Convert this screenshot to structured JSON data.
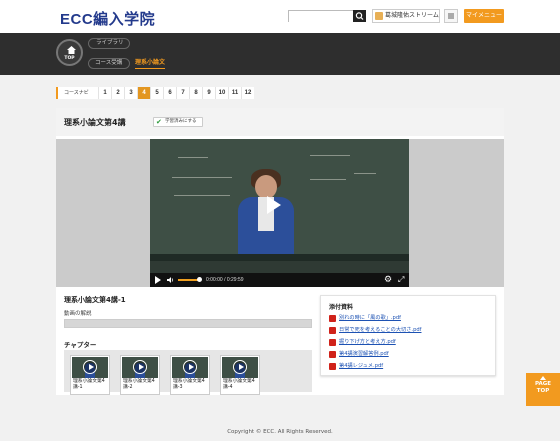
{
  "header": {
    "logo": "ECC編入学院",
    "search": {
      "placeholder": "",
      "value": ""
    },
    "user_name": "葛城隆佑ストリーム",
    "mymenu_label": "マイメニュー"
  },
  "nav": {
    "top_label": "TOP",
    "library_label": "ライブラリ",
    "course_label": "コース受講",
    "current_label": "理系小論文"
  },
  "course_nav": {
    "label": "コースナビ",
    "numbers": [
      "1",
      "2",
      "3",
      "4",
      "5",
      "6",
      "7",
      "8",
      "9",
      "10",
      "11",
      "12"
    ],
    "active_index": 3
  },
  "lesson": {
    "title": "理系小論文第4講",
    "learned_button": "学習済みにする"
  },
  "video": {
    "time": "0:00:00 / 0:29:59",
    "progress": 0.0
  },
  "details": {
    "subtitle": "理系小論文第4講-1",
    "explanation_label": "動画の解説",
    "chapter_label": "チャプター",
    "chapters": [
      {
        "line1": "理系小論文第4",
        "line2": "講-1"
      },
      {
        "line1": "理系小論文第4",
        "line2": "講-2"
      },
      {
        "line1": "理系小論文第4",
        "line2": "講-3"
      },
      {
        "line1": "理系小論文第4",
        "line2": "講-4"
      }
    ]
  },
  "attachments": {
    "title": "添付資料",
    "files": [
      "別れの時に「風の歌」.pdf",
      "日常で死を考えることの大切さ.pdf",
      "掘り下げ方と考え方.pdf",
      "第4講演習解答例.pdf",
      "第4講レジュメ.pdf"
    ]
  },
  "page_top": {
    "line1": "PAGE",
    "line2": "TOP"
  },
  "footer": "Copyright © ECC. All Rights Reserved.",
  "colors": {
    "accent": "#f29a1f",
    "brand": "#233a8c",
    "link": "#1d52b3"
  }
}
